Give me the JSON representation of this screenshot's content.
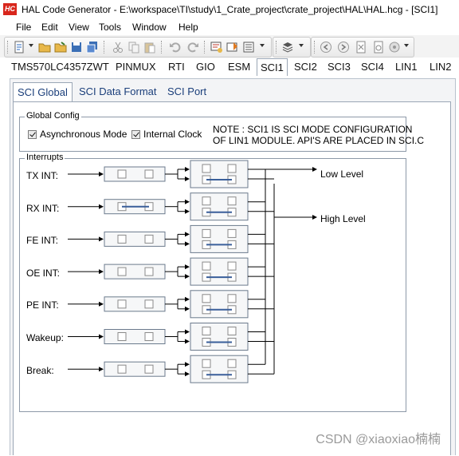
{
  "window": {
    "app_icon_text": "HC",
    "title": "HAL Code Generator - E:\\workspace\\TI\\study\\1_Crate_project\\crate_project\\HAL\\HAL.hcg - [SCI1]"
  },
  "menu": [
    "File",
    "Edit",
    "View",
    "Tools",
    "Window",
    "Help"
  ],
  "toolbar": {
    "icons": [
      "new-file-icon",
      "open-icon",
      "save-icon",
      "save-all-icon",
      "cut-icon",
      "copy-icon",
      "paste-icon",
      "undo-icon",
      "redo-icon",
      "generate-icon",
      "import-icon",
      "list-icon",
      "layers-icon",
      "nav-back-icon",
      "nav-forward-icon",
      "export-icon",
      "settings-icon"
    ]
  },
  "module_tabs": [
    "TMS570LC4357ZWT",
    "PINMUX",
    "RTI",
    "GIO",
    "ESM",
    "SCI1",
    "SCI2",
    "SCI3",
    "SCI4",
    "LIN1",
    "LIN2"
  ],
  "active_module_tab": "SCI1",
  "sub_tabs": [
    "SCI Global",
    "SCI Data Format",
    "SCI Port"
  ],
  "active_sub_tab": "SCI Global",
  "global_config": {
    "title": "Global Config",
    "async_mode_label": "Asynchronous Mode",
    "async_mode_checked": true,
    "internal_clock_label": "Internal Clock",
    "internal_clock_checked": true,
    "note_line1": "NOTE : SCI1 IS SCI MODE CONFIGURATION",
    "note_line2": "OF LIN1 MODULE. API'S ARE PLACED IN SCI.C"
  },
  "interrupts": {
    "title": "Interrupts",
    "rows": [
      "TX INT:",
      "RX INT:",
      "FE INT:",
      "OE INT:",
      "PE INT:",
      "Wakeup:",
      "Break:"
    ],
    "low_level_label": "Low Level",
    "high_level_label": "High Level"
  },
  "watermark": "CSDN @xiaoxiao楠楠"
}
